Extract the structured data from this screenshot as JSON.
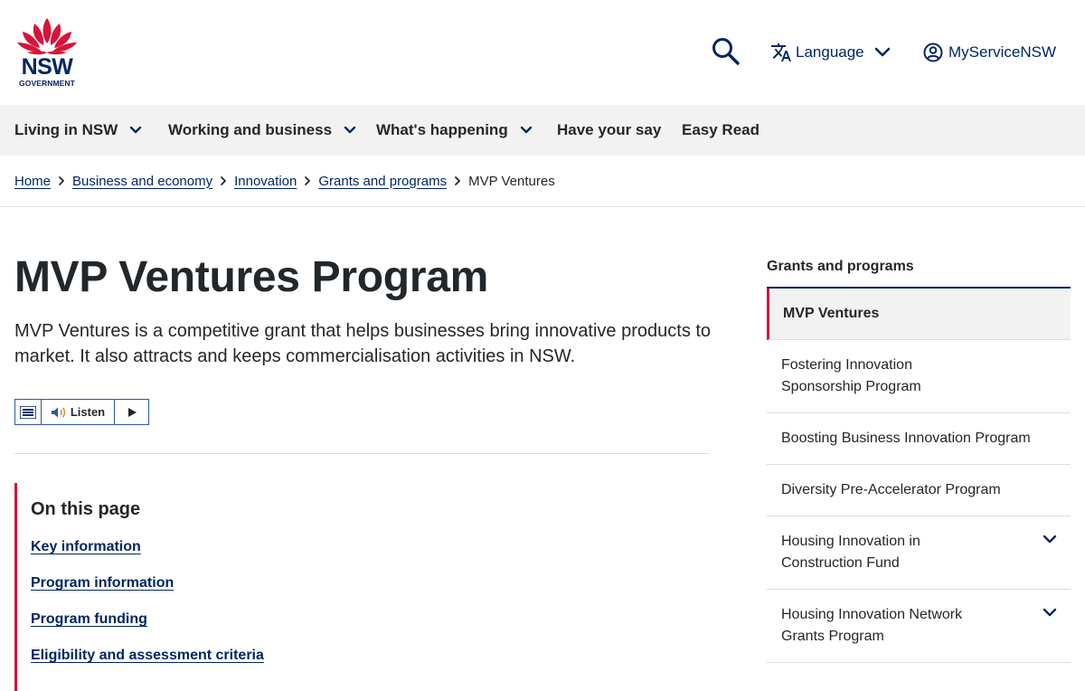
{
  "header": {
    "logo": {
      "wordmark": "NSW",
      "subtext": "GOVERNMENT"
    },
    "language_label": "Language",
    "account_label": "MyServiceNSW"
  },
  "nav": {
    "items": [
      {
        "label": "Living in NSW",
        "has_menu": true
      },
      {
        "label": "Working and business",
        "has_menu": true
      },
      {
        "label": "What's happening",
        "has_menu": true
      },
      {
        "label": "Have your say",
        "has_menu": false
      },
      {
        "label": "Easy Read",
        "has_menu": false
      }
    ]
  },
  "breadcrumb": {
    "items": [
      "Home",
      "Business and economy",
      "Innovation",
      "Grants and programs"
    ],
    "current": "MVP Ventures"
  },
  "main": {
    "title": "MVP Ventures Program",
    "intro": "MVP Ventures is a competitive grant that helps businesses bring innovative products to market. It also attracts and keeps commercialisation activities in NSW.",
    "listen_label": "Listen",
    "on_this_page": {
      "heading": "On this page",
      "links": [
        "Key information",
        "Program information",
        "Program funding",
        "Eligibility and assessment criteria"
      ]
    }
  },
  "sidebar": {
    "heading": "Grants and programs",
    "items": [
      {
        "lines": [
          "MVP Ventures"
        ],
        "active": true,
        "expandable": false
      },
      {
        "lines": [
          "Fostering Innovation",
          "Sponsorship Program"
        ],
        "active": false,
        "expandable": false
      },
      {
        "lines": [
          "Boosting Business Innovation Program"
        ],
        "active": false,
        "expandable": false
      },
      {
        "lines": [
          "Diversity Pre-Accelerator Program"
        ],
        "active": false,
        "expandable": false
      },
      {
        "lines": [
          "Housing Innovation in",
          "Construction Fund"
        ],
        "active": false,
        "expandable": true
      },
      {
        "lines": [
          "Housing Innovation Network",
          "Grants Program"
        ],
        "active": false,
        "expandable": true
      }
    ]
  },
  "icons": {
    "search": "search-icon",
    "language": "translate-icon",
    "account": "user-circle-icon",
    "chevron": "chevron-down-icon",
    "breadcrumb_sep": "chevron-right-icon",
    "speaker": "speaker-icon",
    "play": "play-icon",
    "menu": "menu-icon"
  },
  "colors": {
    "brand_navy": "#002664",
    "accent_red": "#d7153a",
    "nav_bg": "#f2f2f2",
    "text": "#22272b"
  }
}
